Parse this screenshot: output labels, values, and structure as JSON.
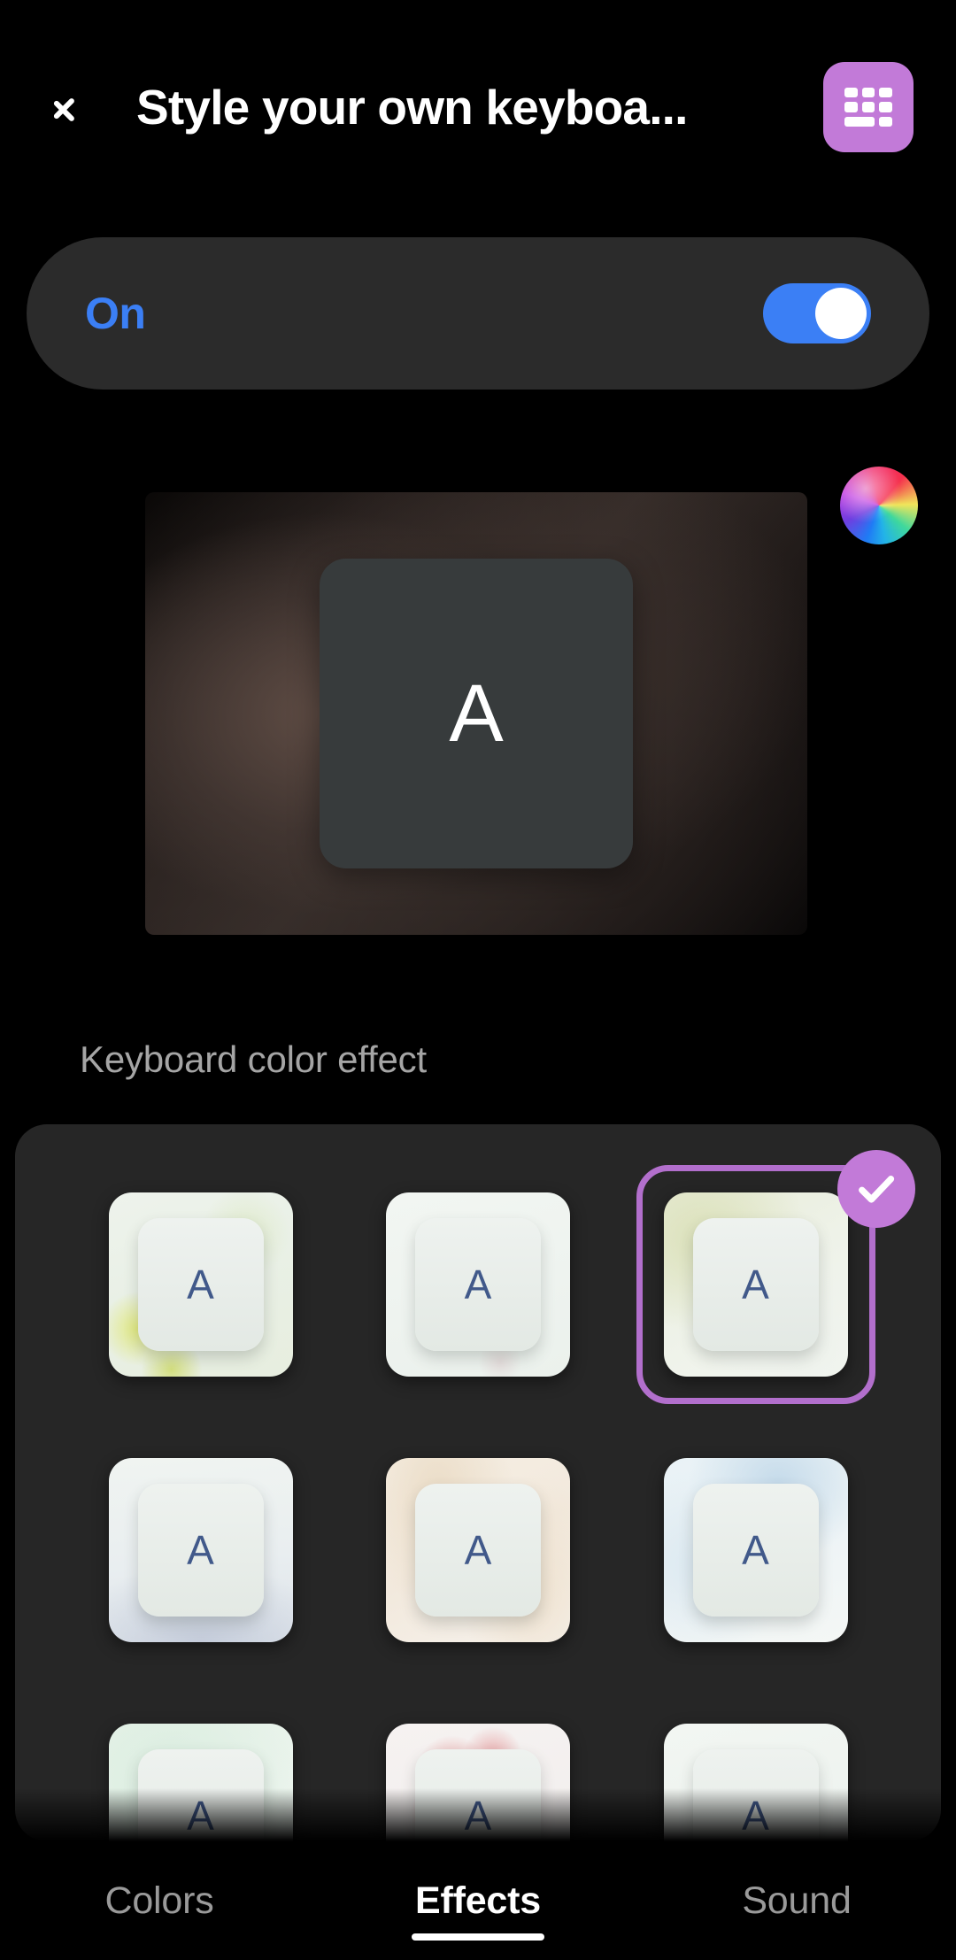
{
  "header": {
    "back_icon": "chevron-left-icon",
    "title": "Style your own keyboa...",
    "app_icon": "keyboard-grid-icon",
    "app_icon_color": "#c27ad8"
  },
  "toggle_row": {
    "label": "On",
    "state": "on",
    "accent_color": "#3b7ff5"
  },
  "preview": {
    "key_letter": "A",
    "key_color": "#373b3c",
    "key_text_color": "#ffffff",
    "background_description": "warm dark brown blurred gradient",
    "color_picker_icon": "color-wheel-icon"
  },
  "section": {
    "label": "Keyboard color effect"
  },
  "effects": {
    "selected_index": 2,
    "selection_color": "#b26fcc",
    "check_icon": "check-icon",
    "letter": "A",
    "letter_color": "#41598a",
    "items": [
      {
        "name": "effect-1",
        "tint": "yellow-green"
      },
      {
        "name": "effect-2",
        "tint": "plain-white"
      },
      {
        "name": "effect-3",
        "tint": "olive-cream",
        "selected": true
      },
      {
        "name": "effect-4",
        "tint": "blue-gray"
      },
      {
        "name": "effect-5",
        "tint": "warm-beige"
      },
      {
        "name": "effect-6",
        "tint": "light-blue"
      },
      {
        "name": "effect-7",
        "tint": "mint-green"
      },
      {
        "name": "effect-8",
        "tint": "pink-red"
      },
      {
        "name": "effect-9",
        "tint": "plain-white"
      }
    ]
  },
  "tabs": [
    {
      "label": "Colors",
      "active": false
    },
    {
      "label": "Effects",
      "active": true
    },
    {
      "label": "Sound",
      "active": false
    }
  ]
}
